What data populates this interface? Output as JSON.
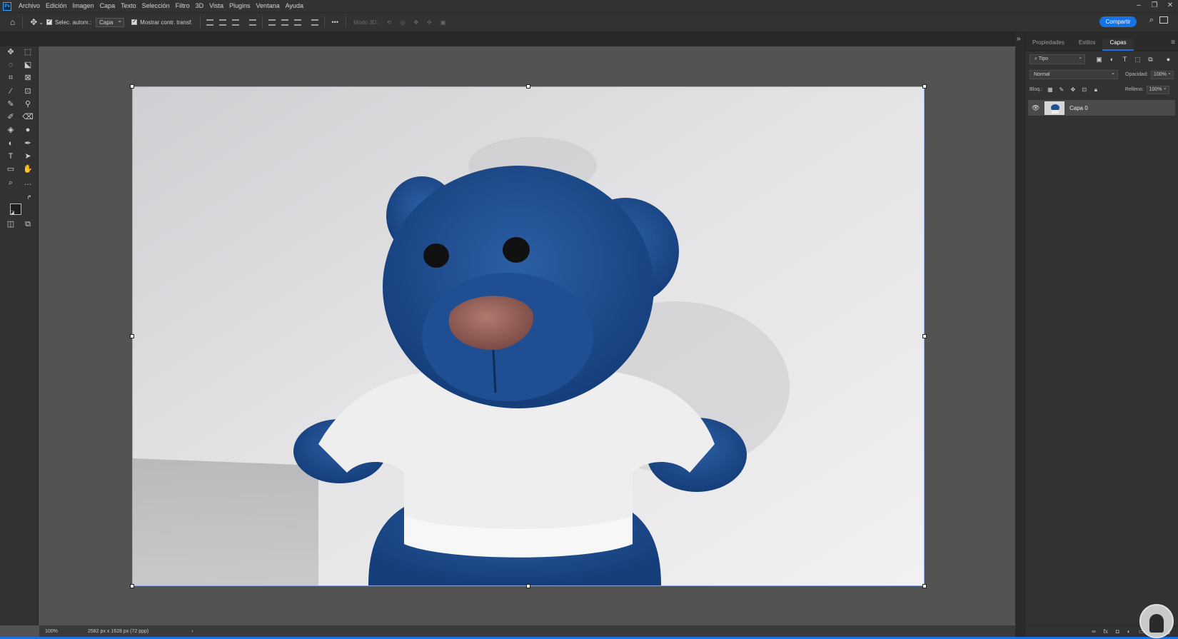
{
  "menu": {
    "items": [
      "Archivo",
      "Edición",
      "Imagen",
      "Capa",
      "Texto",
      "Selección",
      "Filtro",
      "3D",
      "Vista",
      "Plugins",
      "Ventana",
      "Ayuda"
    ],
    "logo_text": "Ps"
  },
  "options": {
    "auto_select_label": "Selec. autom.:",
    "auto_select_value": "Capa",
    "show_transform_label": "Mostrar contr. transf.",
    "mode_3d_label": "Modo 3D:",
    "more_label": "•••",
    "share_label": "Compartir"
  },
  "panel": {
    "tabs": [
      "Propiedades",
      "Estilos",
      "Capas"
    ],
    "active_tab": "Capas",
    "filter_value": "Tipo",
    "blend_mode": "Normal",
    "opacity_label": "Opacidad:",
    "opacity_value": "100%",
    "lock_label": "Bloq.:",
    "fill_label": "Relleno:",
    "fill_value": "100%",
    "layers": [
      {
        "name": "Capa 0",
        "visible": true
      }
    ]
  },
  "status": {
    "zoom": "100%",
    "doc_info": "2582 px x 1628 px (72 ppp)"
  },
  "colors": {
    "accent": "#1473e6",
    "canvas_bg": "#535353",
    "panel_bg": "#323232"
  }
}
